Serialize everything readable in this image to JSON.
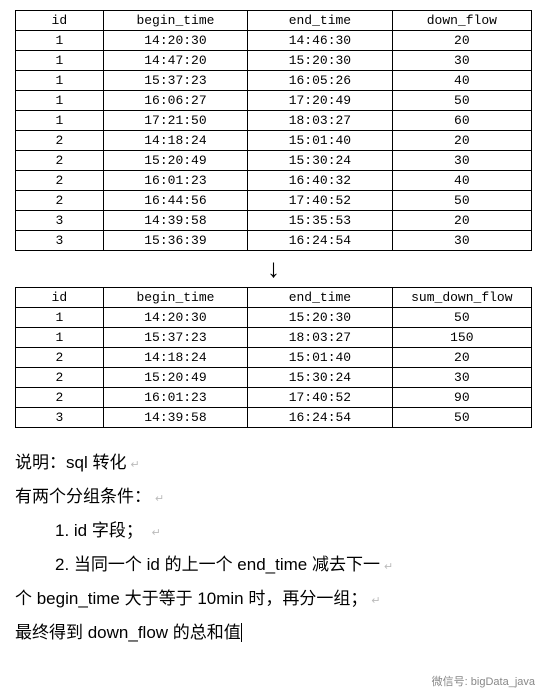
{
  "table1": {
    "headers": [
      "id",
      "begin_time",
      "end_time",
      "down_flow"
    ],
    "rows": [
      [
        "1",
        "14:20:30",
        "14:46:30",
        "20"
      ],
      [
        "1",
        "14:47:20",
        "15:20:30",
        "30"
      ],
      [
        "1",
        "15:37:23",
        "16:05:26",
        "40"
      ],
      [
        "1",
        "16:06:27",
        "17:20:49",
        "50"
      ],
      [
        "1",
        "17:21:50",
        "18:03:27",
        "60"
      ],
      [
        "2",
        "14:18:24",
        "15:01:40",
        "20"
      ],
      [
        "2",
        "15:20:49",
        "15:30:24",
        "30"
      ],
      [
        "2",
        "16:01:23",
        "16:40:32",
        "40"
      ],
      [
        "2",
        "16:44:56",
        "17:40:52",
        "50"
      ],
      [
        "3",
        "14:39:58",
        "15:35:53",
        "20"
      ],
      [
        "3",
        "15:36:39",
        "16:24:54",
        "30"
      ]
    ]
  },
  "arrow": "↓",
  "table2": {
    "headers": [
      "id",
      "begin_time",
      "end_time",
      "sum_down_flow"
    ],
    "rows": [
      [
        "1",
        "14:20:30",
        "15:20:30",
        "50"
      ],
      [
        "1",
        "15:37:23",
        "18:03:27",
        "150"
      ],
      [
        "2",
        "14:18:24",
        "15:01:40",
        "20"
      ],
      [
        "2",
        "15:20:49",
        "15:30:24",
        "30"
      ],
      [
        "2",
        "16:01:23",
        "17:40:52",
        "90"
      ],
      [
        "3",
        "14:39:58",
        "16:24:54",
        "50"
      ]
    ]
  },
  "text": {
    "line1": "说明：sql 转化",
    "line2": "有两个分组条件：",
    "line3": "1. id 字段；",
    "line4": "2. 当同一个 id 的上一个 end_time 减去下一",
    "line5": "个 begin_time 大于等于 10min 时，再分一组；",
    "line6": "最终得到 down_flow 的总和值"
  },
  "footer": "微信号: bigData_java",
  "watermark": ""
}
